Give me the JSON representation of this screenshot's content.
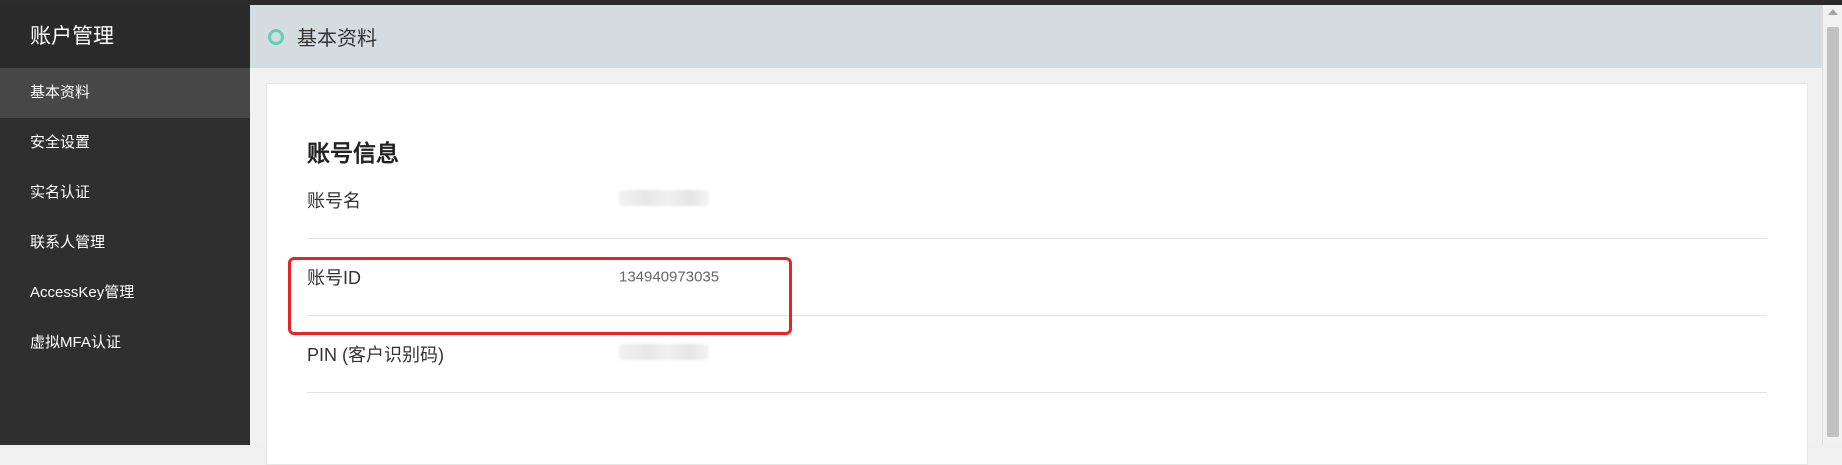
{
  "sidebar": {
    "title": "账户管理",
    "items": [
      {
        "label": "基本资料",
        "active": true
      },
      {
        "label": "安全设置",
        "active": false
      },
      {
        "label": "实名认证",
        "active": false
      },
      {
        "label": "联系人管理",
        "active": false
      },
      {
        "label": "AccessKey管理",
        "active": false
      },
      {
        "label": "虚拟MFA认证",
        "active": false
      }
    ]
  },
  "header": {
    "title": "基本资料",
    "icon": "ring-icon",
    "icon_color": "#5fd0b8"
  },
  "account_info": {
    "section_title": "账号信息",
    "rows": [
      {
        "label": "账号名",
        "value": "",
        "value_blurred": true
      },
      {
        "label": "账号ID",
        "value": "134940973035",
        "value_blurred": false
      },
      {
        "label": "PIN (客户识别码)",
        "value": "",
        "value_blurred": true
      }
    ]
  },
  "highlight": {
    "color": "#e52525",
    "target": "账号ID"
  }
}
